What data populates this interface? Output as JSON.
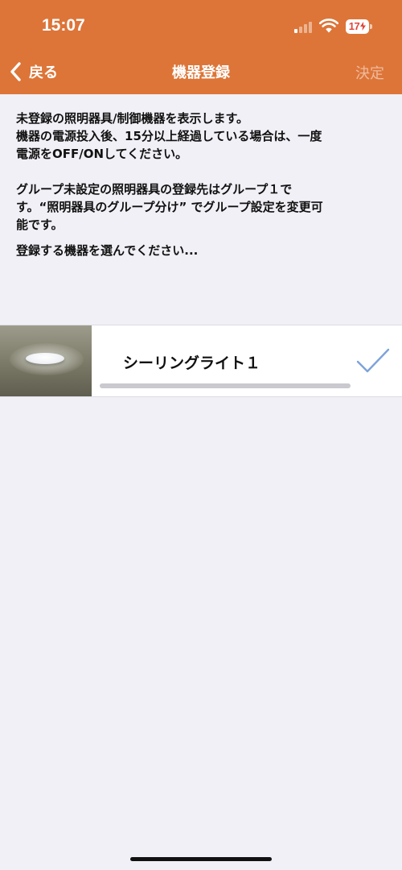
{
  "status_bar": {
    "time": "15:07",
    "battery_level": "17",
    "battery_color": "#e0453a",
    "signal_bars_active": 1,
    "signal_bars_total": 4
  },
  "nav": {
    "back_label": "戻る",
    "title": "機器登録",
    "done_label": "決定"
  },
  "description": {
    "line1": "未登録の照明器具/制御機器を表示します。",
    "line2": "機器の電源投入後、15分以上経過している場合は、一度",
    "line3": "電源をOFF/ONしてください。",
    "line4": "グループ未設定の照明器具の登録先はグループ１で",
    "line5": "す。“照明器具のグループ分け” でグループ設定を変更可",
    "line6": "能です。",
    "line7": "登録する機器を選んでください..."
  },
  "devices": [
    {
      "name": "シーリングライト１",
      "selected": true,
      "progress": 1.0
    }
  ],
  "colors": {
    "header": "#dd7538",
    "background": "#f1f0f6",
    "check": "#7ea3d9"
  },
  "icons": {
    "back": "chevron-left-icon",
    "selected": "checkmark-icon",
    "signal": "cellular-signal-icon",
    "wifi": "wifi-icon",
    "battery": "battery-icon"
  }
}
